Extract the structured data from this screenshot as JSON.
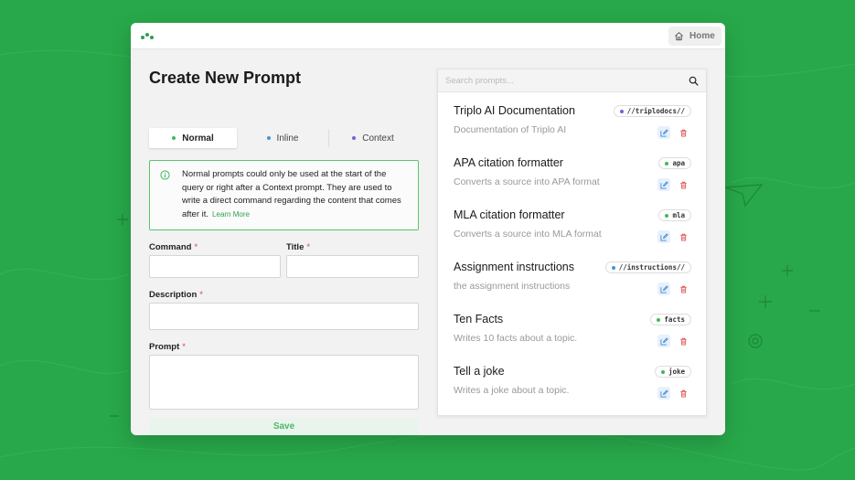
{
  "colors": {
    "background": "#28a84a",
    "accent_green": "#2aa34a",
    "required_red": "#e04646",
    "normal_dot": "#3fb85b",
    "inline_dot": "#4a90d9",
    "context_dot": "#7e5bd6"
  },
  "header": {
    "home_label": "Home",
    "home_icon": "home-icon",
    "logo_icon": "three-dots-logo"
  },
  "form": {
    "title": "Create New Prompt",
    "tabs": [
      {
        "label": "Normal",
        "active": true
      },
      {
        "label": "Inline",
        "active": false
      },
      {
        "label": "Context",
        "active": false
      }
    ],
    "info_text": "Normal prompts could only be used at the start of the query or right after a Context prompt. They are used to write a direct command regarding the content that comes after it.",
    "learn_more": "Learn More",
    "fields": {
      "command_label": "Command",
      "title_label": "Title",
      "description_label": "Description",
      "prompt_label": "Prompt",
      "required_mark": "*"
    },
    "save_label": "Save"
  },
  "prompts_panel": {
    "search_placeholder": "Search prompts...",
    "items": [
      {
        "title": "Triplo AI Documentation",
        "description": "Documentation of Triplo AI",
        "tag": "//triplodocs//",
        "tag_type": "context"
      },
      {
        "title": "APA citation formatter",
        "description": "Converts a source into APA format",
        "tag": "apa",
        "tag_type": "normal"
      },
      {
        "title": "MLA citation formatter",
        "description": "Converts a source into MLA format",
        "tag": "mla",
        "tag_type": "normal"
      },
      {
        "title": "Assignment instructions",
        "description": "the assignment instructions",
        "tag": "//instructions//",
        "tag_type": "inline"
      },
      {
        "title": "Ten Facts",
        "description": "Writes 10 facts about a topic.",
        "tag": "facts",
        "tag_type": "normal"
      },
      {
        "title": "Tell a joke",
        "description": "Writes a joke about a topic.",
        "tag": "joke",
        "tag_type": "normal"
      }
    ]
  }
}
